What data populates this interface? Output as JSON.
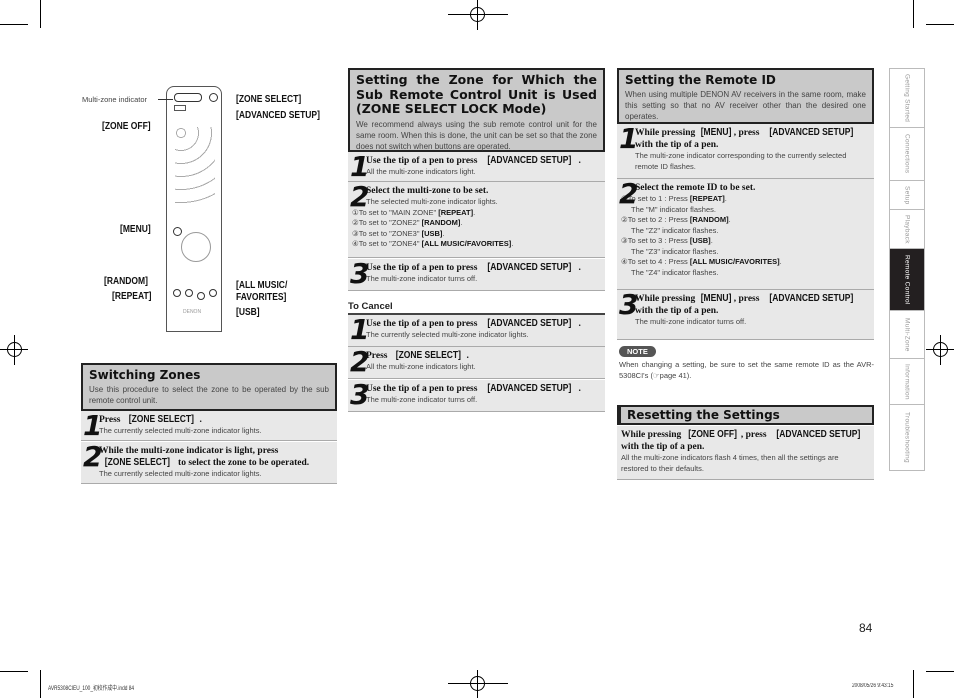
{
  "remote": {
    "indicator_label": "Multi-zone indicator",
    "callouts": [
      "[ZONE SELECT]",
      "[ADVANCED SETUP]",
      "[ZONE OFF]",
      "[MENU]",
      "[RANDOM]",
      "[REPEAT]",
      "[ALL MUSIC/",
      "FAVORITES]",
      "[USB]"
    ]
  },
  "switching": {
    "title": "Switching Zones",
    "intro": "Use this procedure to select the zone to be operated by the sub remote control unit.",
    "steps": [
      {
        "n": "1",
        "title": "Press [ZONE SELECT].",
        "desc": "The currently selected multi-zone indicator lights."
      },
      {
        "n": "2",
        "title": "While the multi-zone indicator is light, press [ZONE SELECT] to select the zone to be operated.",
        "desc": "The currently selected multi-zone indicator lights."
      }
    ]
  },
  "lock": {
    "title": "Setting the Zone for Which the Sub Remote Control Unit is Used (ZONE SELECT LOCK Mode)",
    "intro": "We recommend always using the sub remote control unit for the same room. When this is done, the unit can be set so that the zone does not switch when buttons are operated.",
    "steps": [
      {
        "n": "1",
        "title": "Use the tip of a pen to press [ADVANCED SETUP].",
        "desc": "All the multi-zone indicators light."
      },
      {
        "n": "2",
        "title": "Select the multi-zone to be set.",
        "desc": "The selected multi-zone indicator lights.",
        "options": [
          {
            "text": "①To set to \"MAIN ZONE\"",
            "press": "[REPEAT]"
          },
          {
            "text": "②To set to \"ZONE2\"",
            "press": "[RANDOM]"
          },
          {
            "text": "③To set to \"ZONE3\"",
            "press": "[USB]"
          },
          {
            "text": "④To set to \"ZONE4\"",
            "press": "[ALL MUSIC/FAVORITES]"
          }
        ]
      },
      {
        "n": "3",
        "title": "Use the tip of a pen to press [ADVANCED SETUP].",
        "desc": "The multi-zone indicator turns off."
      }
    ],
    "cancel_title": "To Cancel",
    "cancel_steps": [
      {
        "n": "1",
        "title": "Use the tip of a pen to press [ADVANCED SETUP].",
        "desc": "The currently selected multi-zone indicator lights."
      },
      {
        "n": "2",
        "title": "Press [ZONE SELECT].",
        "desc": "All the multi-zone indicators light."
      },
      {
        "n": "3",
        "title": "Use the tip of a pen to press [ADVANCED SETUP].",
        "desc": "The multi-zone indicator turns off."
      }
    ]
  },
  "remote_id": {
    "title": "Setting the Remote ID",
    "intro": "When using multiple DENON AV receivers in the same room, make this setting so that no AV receiver other than the desired one operates.",
    "steps": [
      {
        "n": "1",
        "title": "While pressing [MENU], press [ADVANCED SETUP] with the tip of a pen.",
        "desc": "The multi-zone indicator corresponding to the currently selected remote ID flashes."
      },
      {
        "n": "2",
        "title": "Select the remote ID to be set.",
        "desc": "",
        "options": [
          {
            "text": "①To set to 1 : Press",
            "press": "[REPEAT]",
            "sub": "The \"M\" indicator flashes."
          },
          {
            "text": "②To set to 2 : Press",
            "press": "[RANDOM]",
            "sub": "The \"Z2\" indicator flashes."
          },
          {
            "text": "③To set to 3 : Press",
            "press": "[USB]",
            "sub": "The \"Z3\" indicator flashes."
          },
          {
            "text": "④To set to 4 : Press",
            "press": "[ALL MUSIC/FAVORITES]",
            "sub": "The \"Z4\" indicator flashes."
          }
        ]
      },
      {
        "n": "3",
        "title": "While pressing [MENU], press [ADVANCED SETUP] with the tip of a pen.",
        "desc": "The multi-zone indicator turns off."
      }
    ],
    "note_label": "NOTE",
    "note_text": "When changing a setting, be sure to set the same remote ID as the AVR-5308CI's (☞page 41)."
  },
  "reset": {
    "title": "Resetting the Settings",
    "step": {
      "n": "",
      "title": "While pressing [ZONE OFF], press [ADVANCED SETUP] with the tip of a pen.",
      "desc": "All the multi-zone indicators flash 4 times, then all the settings are restored to their defaults."
    }
  },
  "tabs": [
    "Getting Started",
    "Connections",
    "Setup",
    "Playback",
    "Remote Control",
    "Multi-Zone",
    "Information",
    "Troubleshooting"
  ],
  "active_tab": "Remote Control",
  "page_number": "84",
  "footer": {
    "file": "AVR5308CIEU_100_初校作成中.indd 84",
    "date": "2008/05/26 9:43:15"
  }
}
